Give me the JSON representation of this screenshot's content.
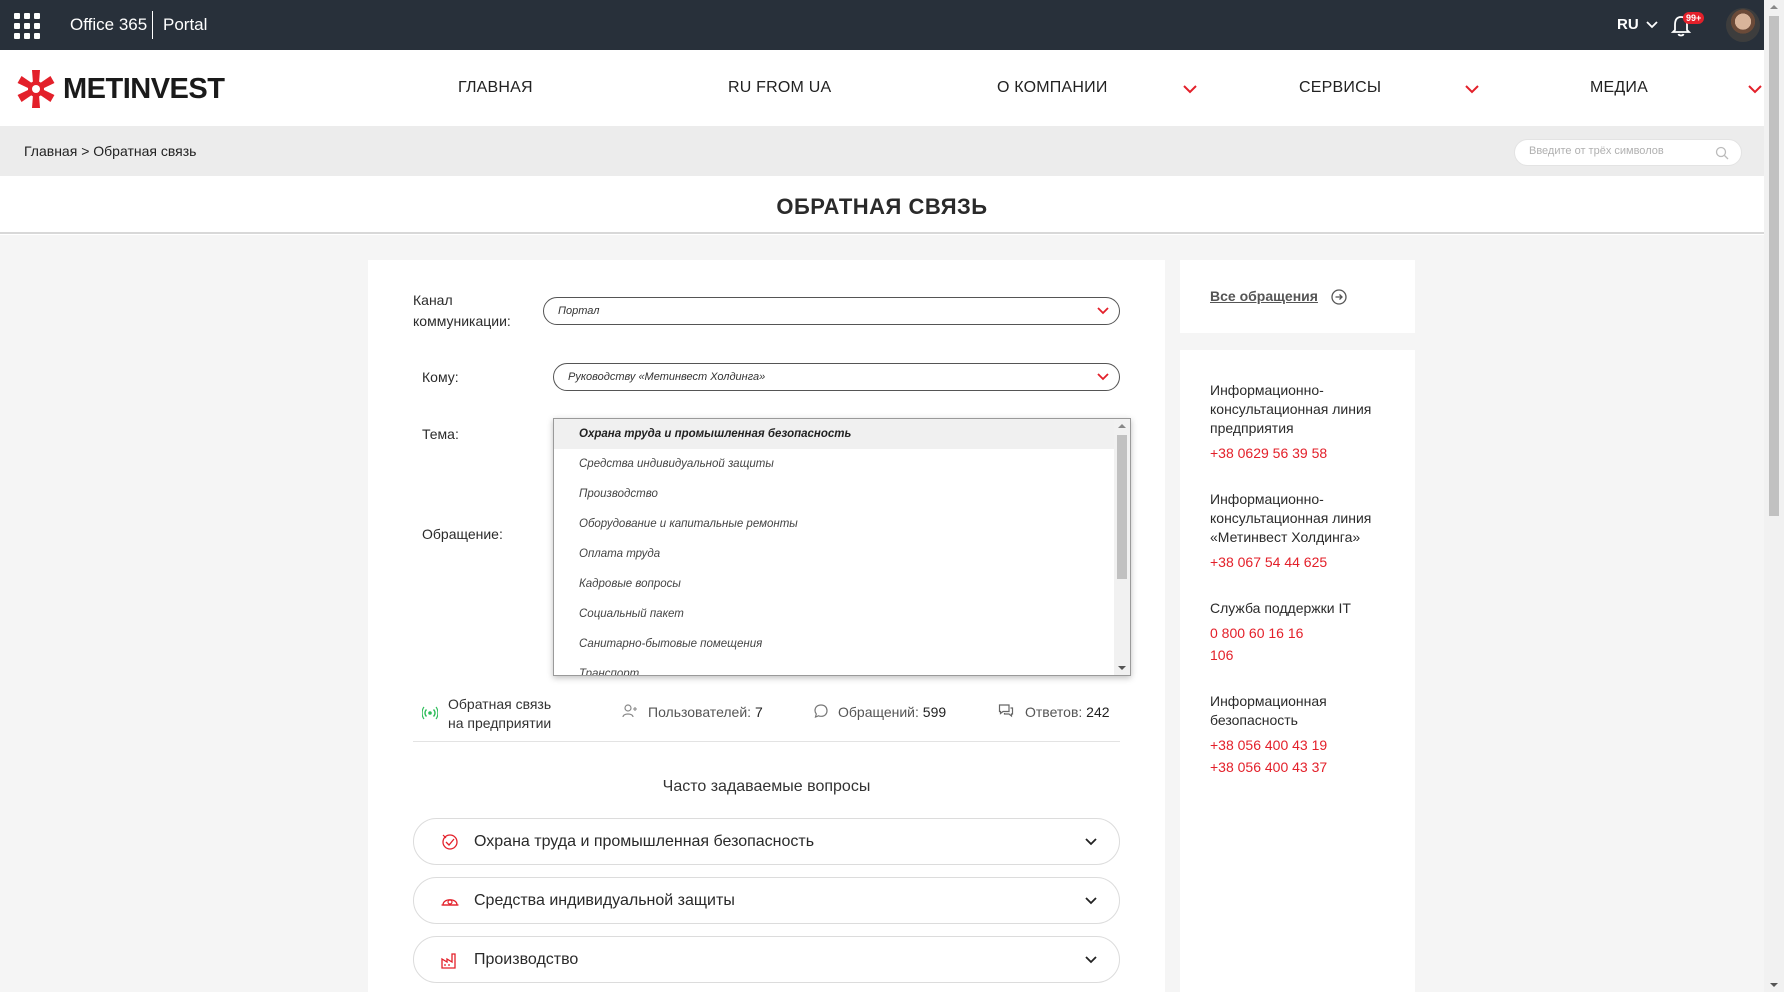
{
  "o365": {
    "title": "Office 365",
    "portal": "Portal",
    "lang": "RU",
    "badge": "99+"
  },
  "header": {
    "logo": "METINVEST",
    "nav": [
      "ГЛАВНАЯ",
      "RU FROM UA",
      "О КОМПАНИИ",
      "СЕРВИСЫ",
      "МЕДИА"
    ]
  },
  "breadcrumb": {
    "home": "Главная",
    "sep": ">",
    "current": "Обратная связь"
  },
  "search": {
    "placeholder": "Введите от трёх символов"
  },
  "page": {
    "title": "ОБРАТНАЯ СВЯЗЬ"
  },
  "form": {
    "channel_label_1": "Канал",
    "channel_label_2": "коммуникации:",
    "channel_value": "Портал",
    "to_label": "Кому:",
    "to_value": "Руководству «Метинвест Холдинга»",
    "topic_label": "Тема:",
    "message_label": "Обращение:"
  },
  "dropdown": {
    "items": [
      "Охрана труда и промышленная безопасность",
      "Средства индивидуальной защиты",
      "Производство",
      "Оборудование и капитальные ремонты",
      "Оплата труда",
      "Кадровые вопросы",
      "Социальный пакет",
      "Санитарно-бытовые помещения",
      "Транспорт"
    ],
    "selected_index": 0
  },
  "stats": {
    "feedback_1": "Обратная связь",
    "feedback_2": "на предприятии",
    "users_label": "Пользователей:",
    "users_value": "7",
    "requests_label": "Обращений:",
    "requests_value": "599",
    "answers_label": "Ответов:",
    "answers_value": "242"
  },
  "faq": {
    "title": "Часто задаваемые вопросы",
    "items": [
      "Охрана труда и промышленная безопасность",
      "Средства индивидуальной защиты",
      "Производство"
    ]
  },
  "sidebar": {
    "all_requests": "Все обращения",
    "blocks": [
      {
        "title_1": "Информационно-",
        "title_2": "консультационная линия",
        "title_3": "предприятия",
        "phones": [
          "+38 0629 56 39 58"
        ]
      },
      {
        "title_1": "Информационно-",
        "title_2": "консультационная линия",
        "title_3": "«Метинвест Холдинга»",
        "phones": [
          "+38 067 54 44 625"
        ]
      },
      {
        "title_1": "Служба поддержки IT",
        "phones": [
          "0 800 60 16 16",
          "106"
        ]
      },
      {
        "title_1": "Информационная",
        "title_2": "безопасность",
        "phones": [
          "+38 056 400 43 19",
          "+38 056 400 43 37"
        ]
      }
    ]
  },
  "colors": {
    "accent": "#e3202a",
    "topbar": "#28303a",
    "green": "#2ebd5a"
  }
}
